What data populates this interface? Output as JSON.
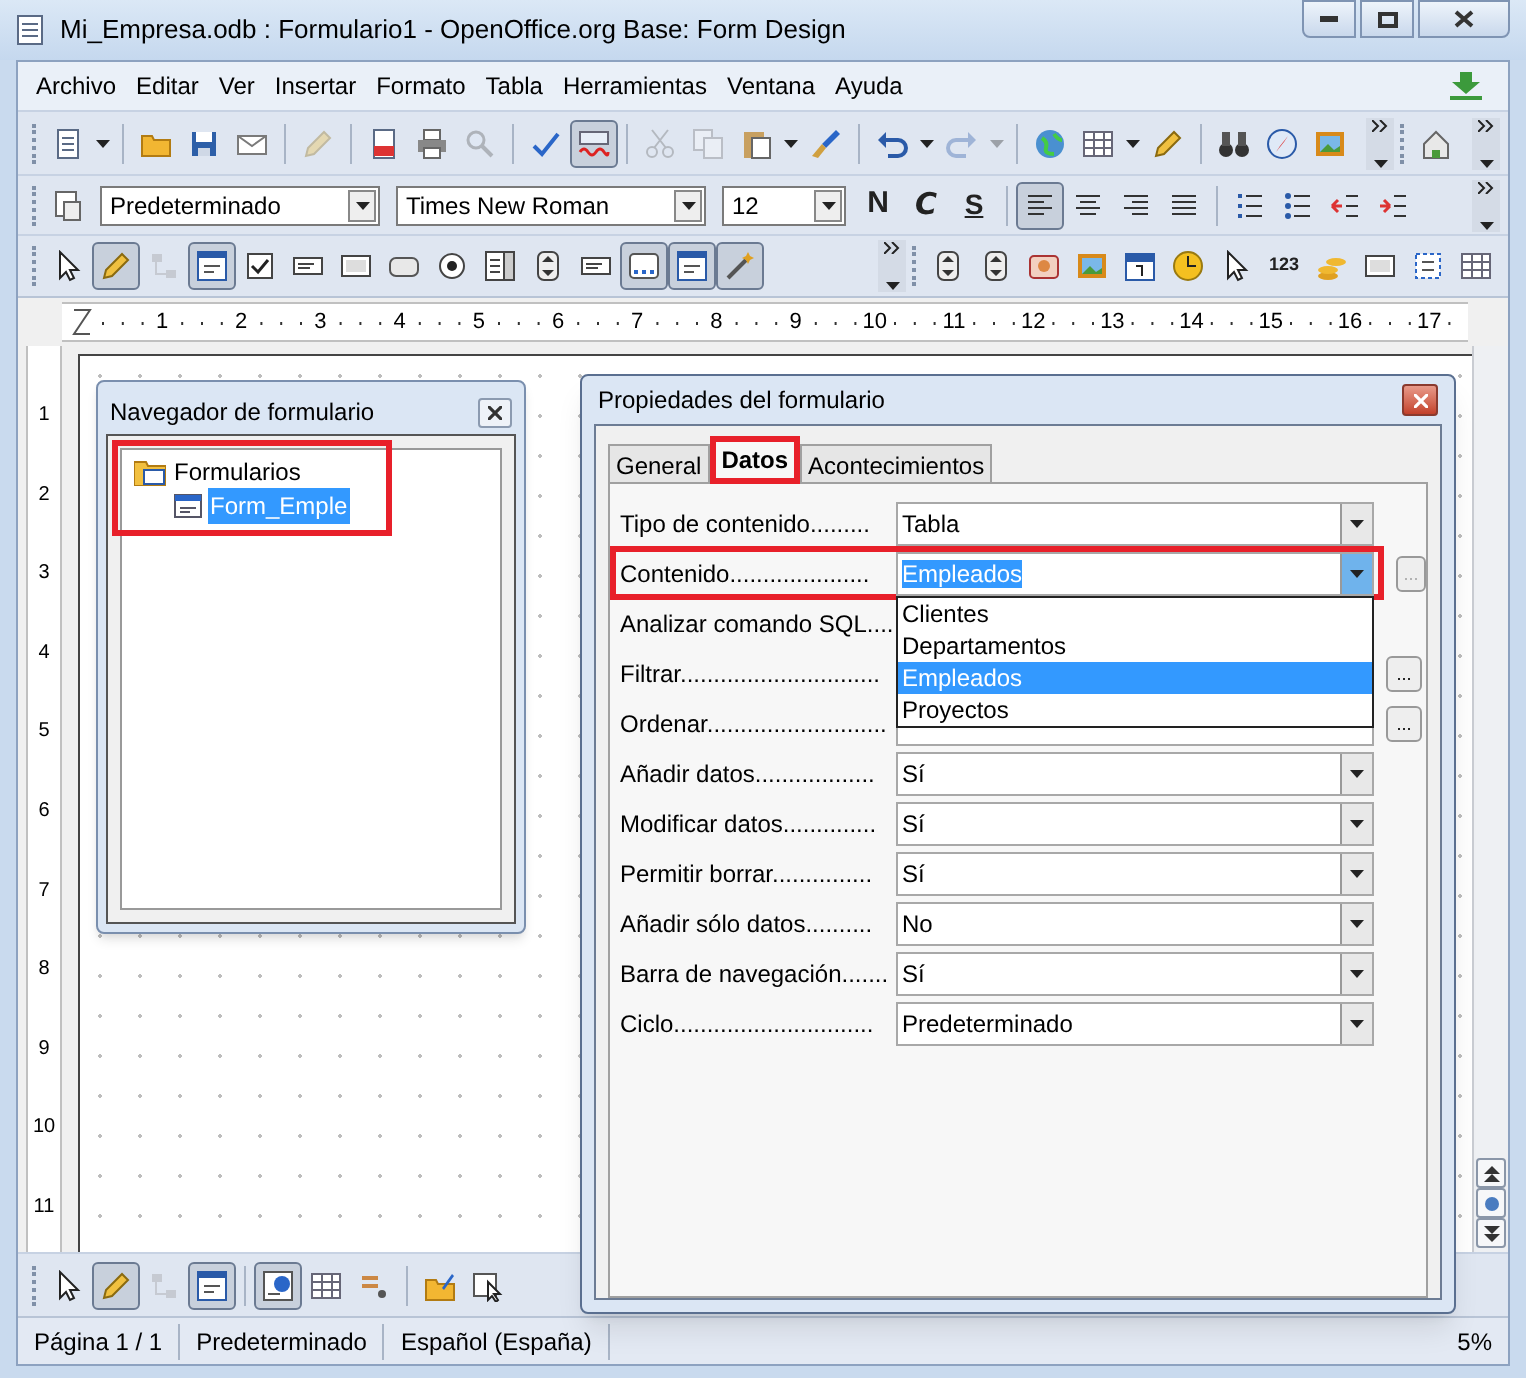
{
  "window": {
    "title": "Mi_Empresa.odb : Formulario1 - OpenOffice.org Base: Form Design"
  },
  "menu": [
    "Archivo",
    "Editar",
    "Ver",
    "Insertar",
    "Formato",
    "Tabla",
    "Herramientas",
    "Ventana",
    "Ayuda"
  ],
  "toolbar_standard": [
    {
      "kind": "grip"
    },
    {
      "kind": "button",
      "pressed": false,
      "disabled": false,
      "menu": true
    },
    {
      "kind": "separator"
    },
    {
      "kind": "button",
      "pressed": false,
      "disabled": false,
      "menu": false
    },
    {
      "kind": "button",
      "pressed": false,
      "disabled": false,
      "menu": false
    },
    {
      "kind": "button",
      "pressed": false,
      "disabled": false,
      "menu": false
    },
    {
      "kind": "separator"
    },
    {
      "kind": "button",
      "pressed": false,
      "disabled": true,
      "menu": false
    },
    {
      "kind": "separator"
    },
    {
      "kind": "button",
      "pressed": false,
      "disabled": false,
      "menu": false
    },
    {
      "kind": "button",
      "pressed": false,
      "disabled": false,
      "menu": false
    },
    {
      "kind": "button",
      "pressed": false,
      "disabled": true,
      "menu": false
    },
    {
      "kind": "separator"
    },
    {
      "kind": "button",
      "pressed": false,
      "disabled": false,
      "menu": false
    },
    {
      "kind": "button",
      "pressed": true,
      "disabled": false,
      "menu": false
    },
    {
      "kind": "separator"
    },
    {
      "kind": "button",
      "pressed": false,
      "disabled": true,
      "menu": false
    },
    {
      "kind": "button",
      "pressed": false,
      "disabled": true,
      "menu": false
    },
    {
      "kind": "button",
      "pressed": false,
      "disabled": false,
      "menu": true
    },
    {
      "kind": "button",
      "pressed": false,
      "disabled": false,
      "menu": false
    },
    {
      "kind": "separator"
    },
    {
      "kind": "button",
      "pressed": false,
      "disabled": false,
      "menu": true
    },
    {
      "kind": "button",
      "pressed": false,
      "disabled": true,
      "menu": true
    },
    {
      "kind": "separator"
    },
    {
      "kind": "button",
      "pressed": false,
      "disabled": false,
      "menu": false
    },
    {
      "kind": "button",
      "pressed": false,
      "disabled": false,
      "menu": true
    },
    {
      "kind": "button",
      "pressed": false,
      "disabled": false,
      "menu": false
    },
    {
      "kind": "separator"
    },
    {
      "kind": "button",
      "pressed": false,
      "disabled": false,
      "menu": false
    },
    {
      "kind": "button",
      "pressed": false,
      "disabled": false,
      "menu": false
    },
    {
      "kind": "button",
      "pressed": false,
      "disabled": false,
      "menu": false
    },
    {
      "kind": "overflow"
    },
    {
      "kind": "grip"
    },
    {
      "kind": "button",
      "pressed": false,
      "disabled": false,
      "menu": false
    },
    {
      "kind": "overflow"
    }
  ],
  "toolbar_format": [
    {
      "kind": "grip"
    },
    {
      "kind": "button",
      "pressed": false,
      "disabled": false,
      "menu": false
    },
    {
      "kind": "combo",
      "value": "Predeterminado"
    },
    {
      "kind": "combo",
      "value": "Times New Roman"
    },
    {
      "kind": "combo",
      "value": "12"
    },
    {
      "kind": "bold_button",
      "label": "N"
    },
    {
      "kind": "italic_button",
      "label": "C"
    },
    {
      "kind": "underline_button",
      "label": "S"
    },
    {
      "kind": "separator"
    },
    {
      "kind": "button",
      "pressed": true,
      "disabled": false,
      "menu": false
    },
    {
      "kind": "button",
      "pressed": false,
      "disabled": false,
      "menu": false
    },
    {
      "kind": "button",
      "pressed": false,
      "disabled": false,
      "menu": false
    },
    {
      "kind": "button",
      "pressed": false,
      "disabled": false,
      "menu": false
    },
    {
      "kind": "separator"
    },
    {
      "kind": "button",
      "pressed": false,
      "disabled": false,
      "menu": false
    },
    {
      "kind": "button",
      "pressed": false,
      "disabled": false,
      "menu": false
    },
    {
      "kind": "button",
      "pressed": false,
      "disabled": false,
      "menu": false
    },
    {
      "kind": "button",
      "pressed": false,
      "disabled": false,
      "menu": false
    },
    {
      "kind": "overflow"
    }
  ],
  "toolbar_controls": [
    {
      "kind": "grip"
    },
    {
      "kind": "button",
      "pressed": false,
      "disabled": false,
      "menu": false
    },
    {
      "kind": "button",
      "pressed": true,
      "disabled": false,
      "menu": false
    },
    {
      "kind": "button",
      "pressed": false,
      "disabled": true,
      "menu": false
    },
    {
      "kind": "button",
      "pressed": true,
      "disabled": false,
      "menu": false
    },
    {
      "kind": "button",
      "pressed": false,
      "disabled": false,
      "menu": false
    },
    {
      "kind": "button",
      "pressed": false,
      "disabled": false,
      "menu": false
    },
    {
      "kind": "button",
      "pressed": false,
      "disabled": false,
      "menu": false
    },
    {
      "kind": "button",
      "pressed": false,
      "disabled": false,
      "menu": false
    },
    {
      "kind": "button",
      "pressed": false,
      "disabled": false,
      "menu": false
    },
    {
      "kind": "button",
      "pressed": false,
      "disabled": false,
      "menu": false
    },
    {
      "kind": "button",
      "pressed": false,
      "disabled": false,
      "menu": false
    },
    {
      "kind": "button",
      "pressed": false,
      "disabled": false,
      "menu": false
    },
    {
      "kind": "button",
      "pressed": true,
      "disabled": false,
      "menu": false
    },
    {
      "kind": "button",
      "pressed": true,
      "disabled": false,
      "menu": false
    },
    {
      "kind": "button",
      "pressed": true,
      "disabled": false,
      "menu": false
    },
    {
      "kind": "overflow"
    },
    {
      "kind": "grip"
    },
    {
      "kind": "button",
      "pressed": false,
      "disabled": false,
      "menu": false
    },
    {
      "kind": "button",
      "pressed": false,
      "disabled": false,
      "menu": false
    },
    {
      "kind": "button",
      "pressed": false,
      "disabled": false,
      "menu": false
    },
    {
      "kind": "button",
      "pressed": false,
      "disabled": false,
      "menu": false
    },
    {
      "kind": "button",
      "pressed": false,
      "disabled": false,
      "menu": false
    },
    {
      "kind": "button",
      "pressed": false,
      "disabled": false,
      "menu": false
    },
    {
      "kind": "button",
      "pressed": false,
      "disabled": false,
      "menu": false
    },
    {
      "kind": "text_button",
      "label": "123"
    },
    {
      "kind": "button",
      "pressed": false,
      "disabled": false,
      "menu": false
    },
    {
      "kind": "button",
      "pressed": false,
      "disabled": false,
      "menu": false
    },
    {
      "kind": "button",
      "pressed": false,
      "disabled": false,
      "menu": false
    },
    {
      "kind": "button",
      "pressed": false,
      "disabled": false,
      "menu": false
    }
  ],
  "ruler": {
    "horizontal": [
      "1",
      "2",
      "3",
      "4",
      "5",
      "6",
      "7",
      "8",
      "9",
      "10",
      "11",
      "12",
      "13",
      "14",
      "15",
      "16",
      "17"
    ],
    "vertical": [
      "1",
      "2",
      "3",
      "4",
      "5",
      "6",
      "7",
      "8",
      "9",
      "10",
      "11"
    ]
  },
  "navigator": {
    "title": "Navegador de formulario",
    "highlighted": true,
    "tree": [
      {
        "label": "Formularios",
        "selected": false,
        "expanded": true,
        "children": [
          {
            "label": "Form_Emple",
            "selected": true
          }
        ]
      }
    ]
  },
  "properties": {
    "title": "Propiedades del formulario",
    "tabs": [
      {
        "label": "General",
        "selected": false,
        "highlighted": false
      },
      {
        "label": "Datos",
        "selected": true,
        "highlighted": true
      },
      {
        "label": "Acontecimientos",
        "selected": false,
        "highlighted": false
      }
    ],
    "rows": [
      {
        "label": "Tipo de contenido.........",
        "kind": "dropdown",
        "value": "Tabla"
      },
      {
        "label": "Contenido.....................",
        "kind": "dropdown",
        "value": "Empleados",
        "value_selected": true,
        "open": true,
        "highlighted": true,
        "button": "...",
        "button_disabled": true,
        "options": [
          {
            "label": "Clientes",
            "selected": false
          },
          {
            "label": "Departamentos",
            "selected": false
          },
          {
            "label": "Empleados",
            "selected": true
          },
          {
            "label": "Proyectos",
            "selected": false
          }
        ]
      },
      {
        "label": "Analizar comando SQL...."
      },
      {
        "label": "Filtrar..............................",
        "kind": "text",
        "button": "...",
        "button_disabled": false
      },
      {
        "label": "Ordenar...........................",
        "kind": "text",
        "button": "...",
        "button_disabled": false
      },
      {
        "label": "Añadir datos..................",
        "kind": "dropdown",
        "value": "Sí"
      },
      {
        "label": "Modificar datos..............",
        "kind": "dropdown",
        "value": "Sí"
      },
      {
        "label": "Permitir borrar...............",
        "kind": "dropdown",
        "value": "Sí"
      },
      {
        "label": "Añadir sólo datos..........",
        "kind": "dropdown",
        "value": "No"
      },
      {
        "label": "Barra de navegación.......",
        "kind": "dropdown",
        "value": "Sí"
      },
      {
        "label": "Ciclo..............................",
        "kind": "dropdown",
        "value": "Predeterminado"
      }
    ]
  },
  "status_bar": [
    "Página 1 / 1",
    "Predeterminado",
    "Español (España)",
    "5%"
  ]
}
